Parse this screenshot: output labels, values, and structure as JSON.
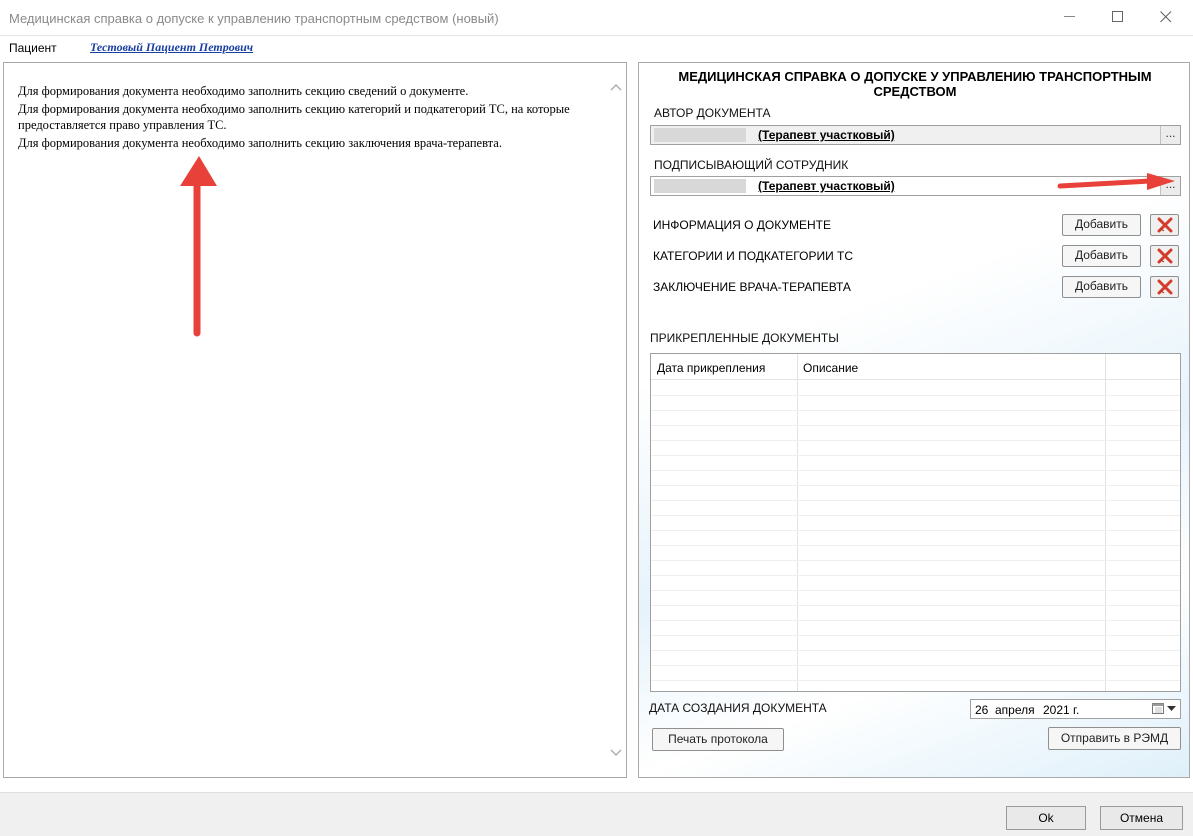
{
  "window": {
    "title": "Медицинская справка о допуске к управлению транспортным средством (новый)"
  },
  "patient": {
    "label": "Пациент",
    "name": "Тестовый Пациент Петрович"
  },
  "messages": [
    "Для формирования документа необходимо заполнить секцию сведений о документе.",
    "Для формирования документа необходимо заполнить секцию категорий и подкатегорий ТС, на которые предоставляется право управления ТС.",
    "Для формирования документа необходимо заполнить секцию заключения врача-терапевта."
  ],
  "document": {
    "heading": "МЕДИЦИНСКАЯ СПРАВКА О ДОПУСКЕ У УПРАВЛЕНИЮ ТРАНСПОРТНЫМ СРЕДСТВОМ",
    "author_label": "АВТОР ДОКУМЕНТА",
    "author_value": "(Терапевт участковый)",
    "signer_label": "ПОДПИСЫВАЮЩИЙ СОТРУДНИК",
    "signer_value": "(Терапевт участковый)",
    "lookup_button": "...",
    "sections": [
      {
        "label": "ИНФОРМАЦИЯ О ДОКУМЕНТЕ",
        "add_label": "Добавить"
      },
      {
        "label": "КАТЕГОРИИ И ПОДКАТЕГОРИИ ТС",
        "add_label": "Добавить"
      },
      {
        "label": "ЗАКЛЮЧЕНИЕ ВРАЧА-ТЕРАПЕВТА",
        "add_label": "Добавить"
      }
    ],
    "attached_label": "ПРИКРЕПЛЕННЫЕ ДОКУМЕНТЫ",
    "attached_columns": [
      "Дата прикрепления",
      "Описание"
    ],
    "date_label": "ДАТА СОЗДАНИЯ ДОКУМЕНТА",
    "date": {
      "day": "26",
      "month": "апреля",
      "year": "2021 г."
    },
    "print_button": "Печать протокола",
    "send_button": "Отправить в РЭМД"
  },
  "footer": {
    "ok_label": "Ok",
    "cancel_label": "Отмена"
  },
  "colors": {
    "annotation_arrow": "#e8413a",
    "patient_link": "#1a3fa3",
    "delete_icon": "#d43b2b"
  }
}
